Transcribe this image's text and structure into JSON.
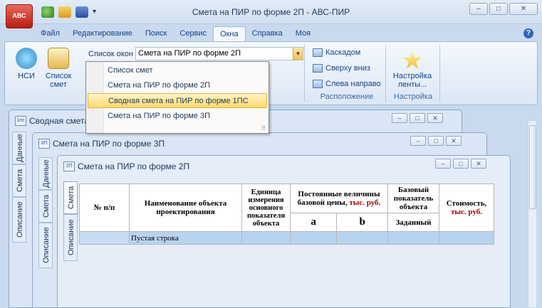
{
  "window": {
    "title": "Смета на ПИР по форме 2П - АВС-ПИР",
    "app_logo": "АВС",
    "controls": {
      "minimize": "–",
      "maximize": "□",
      "close": "✕"
    },
    "qat_more": "▾"
  },
  "ribbon": {
    "tabs": [
      "Файл",
      "Редактирование",
      "Поиск",
      "Сервис",
      "Окна",
      "Справка",
      "Моя"
    ],
    "active_tab": "Окна",
    "help": "?",
    "nsi_label": "НСИ",
    "spisok_label_1": "Список",
    "spisok_label_2": "смет",
    "window_list_label": "Список окон",
    "window_list_value": "Смета на ПИР по форме 2П",
    "arrange": {
      "cascade": "Каскадом",
      "top_down": "Сверху вниз",
      "left_right": "Слева направо",
      "group_title": "Расположение"
    },
    "ribbon_settings": {
      "label_1": "Настройка",
      "label_2": "ленты...",
      "group_title": "Настройка"
    }
  },
  "dropdown": {
    "items": [
      "Список смет",
      "Смета на ПИР по форме 2П",
      "Сводная смета на ПИР по форме 1ПС",
      "Смета на ПИР по форме 3П"
    ],
    "highlighted_index": 2,
    "grip": "⠿"
  },
  "mdi_windows": [
    {
      "icon": "1пс",
      "title": "Сводная смета",
      "tabs": [
        "Описание",
        "Смета",
        "Данные"
      ]
    },
    {
      "icon": "3П",
      "title": "Смета на ПИР по форме 3П",
      "tabs": [
        "Описание",
        "Смета",
        "Данные"
      ]
    },
    {
      "icon": "2П",
      "title": "Смета на ПИР по форме 2П",
      "tabs": [
        "Описание",
        "Смета"
      ]
    }
  ],
  "table": {
    "h_num": "№ п/п",
    "h_name": "Наименование объекта проектирования",
    "h_unit": "Единица измерения основного показателя объекта",
    "h_const_1": "Постоянные величины базовой цены,",
    "h_const_unit": "тыс. руб.",
    "h_base": "Базовый показатель объекта",
    "h_cost": "Стоимость,",
    "h_cost_unit": "тыс. руб.",
    "h_a": "a",
    "h_b": "b",
    "h_given": "Заданный",
    "rows": [
      {
        "num": "",
        "name": "Пустая строка"
      }
    ]
  },
  "colors": {
    "accent": "#15428b",
    "ribbon_bg": "#dce7f5",
    "row_highlight": "#b8d3ef",
    "red_text": "#a30000"
  }
}
